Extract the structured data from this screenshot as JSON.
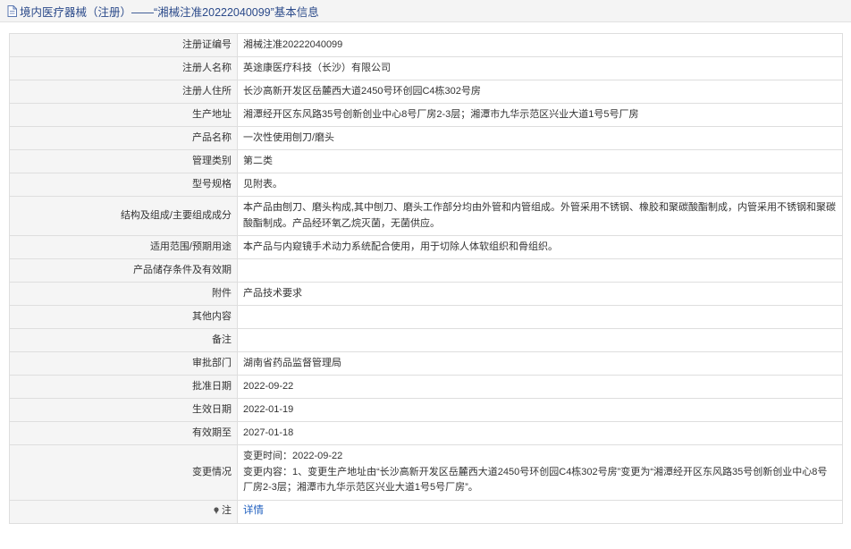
{
  "header": {
    "title": "境内医疗器械（注册）——“湘械注准20222040099”基本信息",
    "icon": "document-icon"
  },
  "rows": [
    {
      "label": "注册证编号",
      "value": "湘械注准20222040099"
    },
    {
      "label": "注册人名称",
      "value": "英途康医疗科技（长沙）有限公司"
    },
    {
      "label": "注册人住所",
      "value": "长沙高新开发区岳麓西大道2450号环创园C4栋302号房"
    },
    {
      "label": "生产地址",
      "value": "湘潭经开区东风路35号创新创业中心8号厂房2-3层；湘潭市九华示范区兴业大道1号5号厂房"
    },
    {
      "label": "产品名称",
      "value": "一次性使用刨刀/磨头"
    },
    {
      "label": "管理类别",
      "value": "第二类"
    },
    {
      "label": "型号规格",
      "value": "见附表。"
    },
    {
      "label": "结构及组成/主要组成成分",
      "value": "本产品由刨刀、磨头构成,其中刨刀、磨头工作部分均由外管和内管组成。外管采用不锈钢、橡胶和聚碳酸酯制成，内管采用不锈钢和聚碳酸酯制成。产品经环氧乙烷灭菌，无菌供应。"
    },
    {
      "label": "适用范围/预期用途",
      "value": "本产品与内窥镜手术动力系统配合使用，用于切除人体软组织和骨组织。"
    },
    {
      "label": "产品储存条件及有效期",
      "value": ""
    },
    {
      "label": "附件",
      "value": "产品技术要求"
    },
    {
      "label": "其他内容",
      "value": ""
    },
    {
      "label": "备注",
      "value": ""
    },
    {
      "label": "审批部门",
      "value": "湖南省药品监督管理局"
    },
    {
      "label": "批准日期",
      "value": "2022-09-22"
    },
    {
      "label": "生效日期",
      "value": "2022-01-19"
    },
    {
      "label": "有效期至",
      "value": "2027-01-18"
    }
  ],
  "change": {
    "label": "变更情况",
    "time_line": "变更时间：2022-09-22",
    "content_line": "变更内容：1、变更生产地址由“长沙高新开发区岳麓西大道2450号环创园C4栋302号房”变更为“湘潭经开区东风路35号创新创业中心8号厂房2-3层；湘潭市九华示范区兴业大道1号5号厂房”。"
  },
  "note": {
    "label": "注",
    "icon": "pin-icon",
    "link_text": "详情"
  }
}
